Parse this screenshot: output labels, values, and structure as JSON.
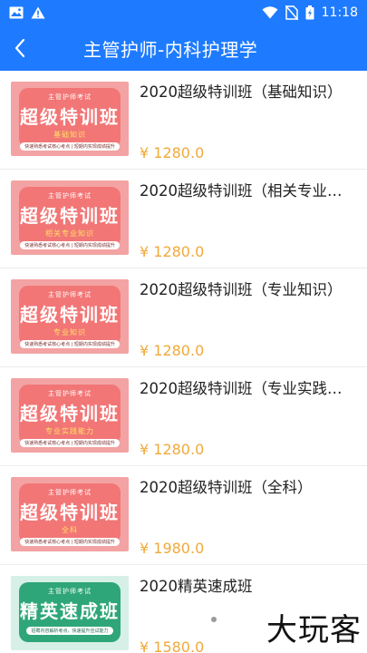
{
  "status_bar": {
    "time": "11:18",
    "icons": [
      "image-icon",
      "warning-icon",
      "wifi-icon",
      "no-sim-icon",
      "battery-charging-icon"
    ]
  },
  "header": {
    "title": "主管护师-内科护理学",
    "back_icon": "back-arrow-icon",
    "color": "#1e7bff"
  },
  "courses": [
    {
      "title": "2020超级特训班（基础知识）",
      "price": "¥ 1280.0",
      "thumb": {
        "top": "主管护师考试",
        "main": "超级特训班",
        "sub": "基础知识",
        "note": "快速熟悉考试核心考点 | 短期内实现成绩提升",
        "theme": "red"
      }
    },
    {
      "title": "2020超级特训班（相关专业…",
      "price": "¥ 1280.0",
      "thumb": {
        "top": "主管护师考试",
        "main": "超级特训班",
        "sub": "相关专业知识",
        "note": "快速熟悉考试核心考点 | 短期内实现成绩提升",
        "theme": "red"
      }
    },
    {
      "title": "2020超级特训班（专业知识）",
      "price": "¥ 1280.0",
      "thumb": {
        "top": "主管护师考试",
        "main": "超级特训班",
        "sub": "专业知识",
        "note": "快速熟悉考试核心考点 | 短期内实现成绩提升",
        "theme": "red"
      }
    },
    {
      "title": "2020超级特训班（专业实践…",
      "price": "¥ 1280.0",
      "thumb": {
        "top": "主管护师考试",
        "main": "超级特训班",
        "sub": "专业实践能力",
        "note": "快速熟悉考试核心考点 | 短期内实现成绩提升",
        "theme": "red"
      }
    },
    {
      "title": "2020超级特训班（全科）",
      "price": "¥ 1980.0",
      "thumb": {
        "top": "主管护师考试",
        "main": "超级特训班",
        "sub": "全科",
        "note": "快速熟悉考试核心考点 | 短期内实现成绩提升",
        "theme": "red"
      }
    },
    {
      "title": "2020精英速成班",
      "price": "¥ 1580.0",
      "thumb": {
        "top": "主管护师考试",
        "main": "精英速成班",
        "sub": "",
        "note": "招聘内容解析考点，快速提升应试能力",
        "theme": "green"
      }
    }
  ],
  "colors": {
    "price": "#f0a93a",
    "accent": "#1e7bff"
  },
  "watermark": "大玩客"
}
